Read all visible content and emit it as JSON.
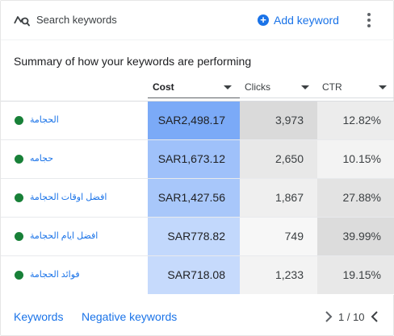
{
  "header": {
    "search_label": "Search keywords",
    "add_keyword_label": "Add keyword"
  },
  "summary_title": "Summary of how your keywords are performing",
  "columns": [
    {
      "label": "Cost",
      "active": true
    },
    {
      "label": "Clicks",
      "active": false
    },
    {
      "label": "CTR",
      "active": false
    }
  ],
  "rows": [
    {
      "keyword": "الحجامة",
      "status": "green",
      "cost": "SAR2,498.17",
      "clicks": "3,973",
      "ctr": "12.82%",
      "cost_shade": "#7baaf7",
      "clicks_shade": "#dadada",
      "ctr_shade": "#ececec"
    },
    {
      "keyword": "حجامه",
      "status": "green",
      "cost": "SAR1,673.12",
      "clicks": "2,650",
      "ctr": "10.15%",
      "cost_shade": "#9fc1fa",
      "clicks_shade": "#e8e8e8",
      "ctr_shade": "#f3f3f3"
    },
    {
      "keyword": "افضل اوقات الحجامة",
      "status": "green",
      "cost": "SAR1,427.56",
      "clicks": "1,867",
      "ctr": "27.88%",
      "cost_shade": "#a8c7fa",
      "clicks_shade": "#efefef",
      "ctr_shade": "#e3e3e3"
    },
    {
      "keyword": "افضل ايام الحجامة",
      "status": "green",
      "cost": "SAR778.82",
      "clicks": "749",
      "ctr": "39.99%",
      "cost_shade": "#c2d8fc",
      "clicks_shade": "#f7f7f7",
      "ctr_shade": "#dcdcdc"
    },
    {
      "keyword": "فوائد الحجامة",
      "status": "green",
      "cost": "SAR718.08",
      "clicks": "1,233",
      "ctr": "19.15%",
      "cost_shade": "#c6dafc",
      "clicks_shade": "#f3f3f3",
      "ctr_shade": "#e8e8e8"
    }
  ],
  "footer": {
    "keywords_link": "Keywords",
    "negative_keywords_link": "Negative keywords",
    "pager": "1 / 10"
  },
  "colors": {
    "accent": "#1a73e8",
    "status_green": "#188038"
  },
  "icons": {
    "search": "search-keywords-icon",
    "add": "add-circle-icon",
    "more": "more-vert-icon",
    "prev": "chevron-left-icon",
    "next": "chevron-right-icon"
  }
}
